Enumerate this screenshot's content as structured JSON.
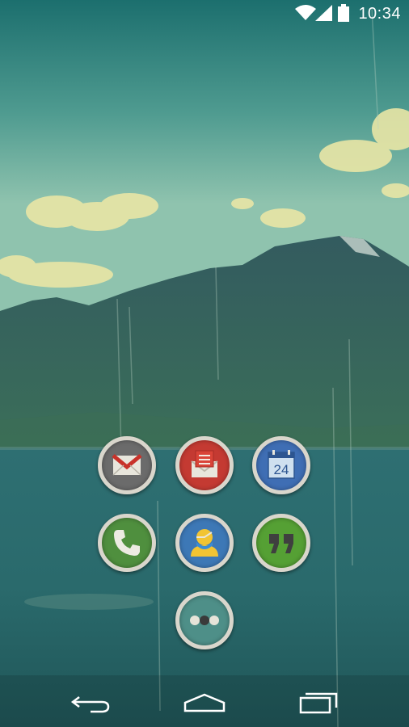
{
  "status_bar": {
    "time": "10:34",
    "icons": [
      "wifi-icon",
      "cell-signal-icon",
      "battery-icon"
    ]
  },
  "home_screen": {
    "apps": [
      {
        "name": "gmail",
        "icon": "gmail-icon",
        "color": "#6e6e6e"
      },
      {
        "name": "email",
        "icon": "email-icon",
        "color": "#c43a32"
      },
      {
        "name": "calendar",
        "icon": "calendar-icon",
        "color": "#3f6eb4",
        "day": "24"
      },
      {
        "name": "phone",
        "icon": "phone-icon",
        "color": "#4f8f3e"
      },
      {
        "name": "contacts",
        "icon": "person-icon",
        "color": "#3d78b6"
      },
      {
        "name": "hangouts",
        "icon": "quote-icon",
        "color": "#55a034"
      },
      {
        "name": "app-drawer",
        "icon": "app-drawer-icon",
        "color": "#4e8f88"
      }
    ]
  },
  "nav_bar": {
    "buttons": [
      "back-icon",
      "home-icon",
      "recent-apps-icon"
    ]
  }
}
